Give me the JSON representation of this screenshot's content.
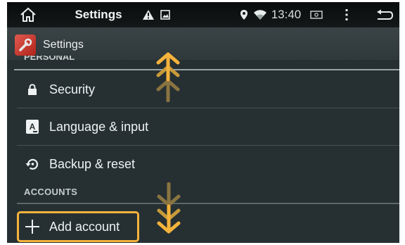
{
  "status_bar": {
    "title": "Settings",
    "time": "13:40",
    "icons": [
      "home-icon",
      "warning-icon",
      "image-icon",
      "location-icon",
      "wifi-icon",
      "screenshot-icon",
      "menu-icon",
      "back-icon"
    ]
  },
  "action_bar": {
    "title": "Settings",
    "icon": "settings-wrench-icon"
  },
  "sections": {
    "personal_cut": "PERSONAL",
    "accounts": "ACCOUNTS"
  },
  "items": [
    {
      "label": "Security",
      "icon": "lock-icon"
    },
    {
      "label": "Language & input",
      "icon": "keyboard-a-icon"
    },
    {
      "label": "Backup & reset",
      "icon": "restore-icon"
    }
  ],
  "add_account": {
    "label": "Add account",
    "icon": "plus-icon"
  },
  "colors": {
    "highlight": "#f5b33c",
    "background": "#263033"
  }
}
